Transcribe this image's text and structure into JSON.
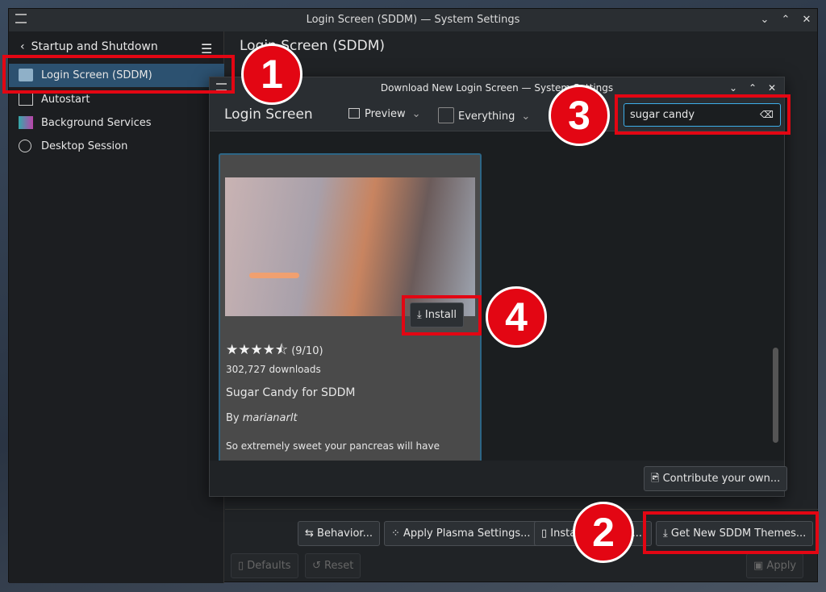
{
  "window": {
    "title": "Login Screen (SDDM) — System Settings",
    "controls": [
      "⌄",
      "⌃",
      "✕"
    ]
  },
  "sidebar": {
    "back_label": "Startup and Shutdown",
    "items": [
      {
        "label": "Login Screen (SDDM)",
        "icon": "monitor-icon",
        "selected": true
      },
      {
        "label": "Autostart",
        "icon": "autostart-icon"
      },
      {
        "label": "Background Services",
        "icon": "background-services-icon"
      },
      {
        "label": "Desktop Session",
        "icon": "desktop-session-icon"
      }
    ]
  },
  "main": {
    "title": "Login Screen (SDDM)",
    "buttons": {
      "behavior": "Behavior...",
      "apply_plasma": "Apply Plasma Settings...",
      "install_file": "Install From File...",
      "get_new": "Get New SDDM Themes...",
      "defaults": "Defaults",
      "reset": "Reset",
      "apply": "Apply"
    }
  },
  "dialog": {
    "title": "Download New Login Screen — System Settings",
    "heading": "Login Screen",
    "preview": "Preview",
    "filter": "Everything",
    "search": {
      "value": "sugar candy"
    },
    "card": {
      "rating_stars": 4.5,
      "rating_text": "(9/10)",
      "downloads": "302,727 downloads",
      "name": "Sugar Candy for SDDM",
      "by": "By ",
      "author": "marianarlt",
      "description": "So extremely sweet your pancreas will have",
      "install": "Install"
    },
    "contribute": "Contribute your own...",
    "scroll_position": 0.75
  },
  "annotations": [
    "1",
    "2",
    "3",
    "4"
  ],
  "colors": {
    "accent": "#2c5170",
    "annotation": "#e30613"
  }
}
